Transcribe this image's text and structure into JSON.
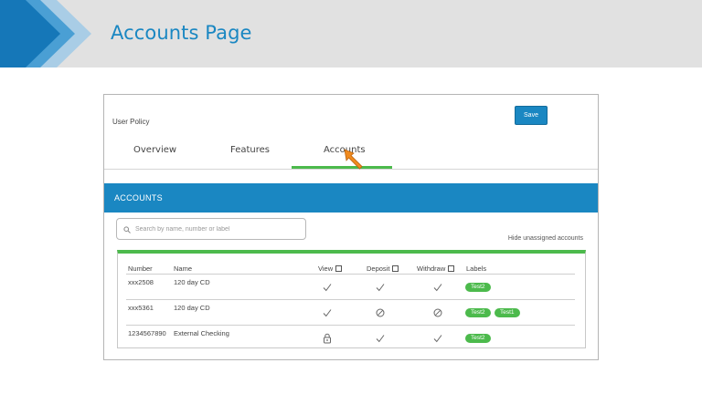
{
  "header": {
    "title": "Accounts Page"
  },
  "panel": {
    "policy_label": "User Policy",
    "save_label": "Save",
    "tabs": [
      {
        "label": "Overview",
        "active": false
      },
      {
        "label": "Features",
        "active": false
      },
      {
        "label": "Accounts",
        "active": true
      }
    ]
  },
  "accounts": {
    "title": "ACCOUNTS",
    "search_placeholder": "Search by name, number or label",
    "hide_link": "Hide unassigned accounts",
    "columns": {
      "number": "Number",
      "name": "Name",
      "view": "View",
      "deposit": "Deposit",
      "withdraw": "Withdraw",
      "labels": "Labels"
    },
    "rows": [
      {
        "number": "xxx2508",
        "name": "120 day CD",
        "view": "check-icon",
        "deposit": "check-icon",
        "withdraw": "check-icon",
        "labels": [
          "Test2"
        ]
      },
      {
        "number": "xxx5361",
        "name": "120 day CD",
        "view": "check-icon",
        "deposit": "blocked-icon",
        "withdraw": "blocked-icon",
        "labels": [
          "Test2",
          "Test1"
        ]
      },
      {
        "number": "1234567890",
        "name": "External Checking",
        "view": "lock-icon",
        "deposit": "check-icon",
        "withdraw": "check-icon",
        "labels": [
          "Test2"
        ]
      }
    ]
  },
  "colors": {
    "brand_blue": "#1a87c2",
    "accent_green": "#4cba4c",
    "header_gray": "#e1e1e1"
  }
}
